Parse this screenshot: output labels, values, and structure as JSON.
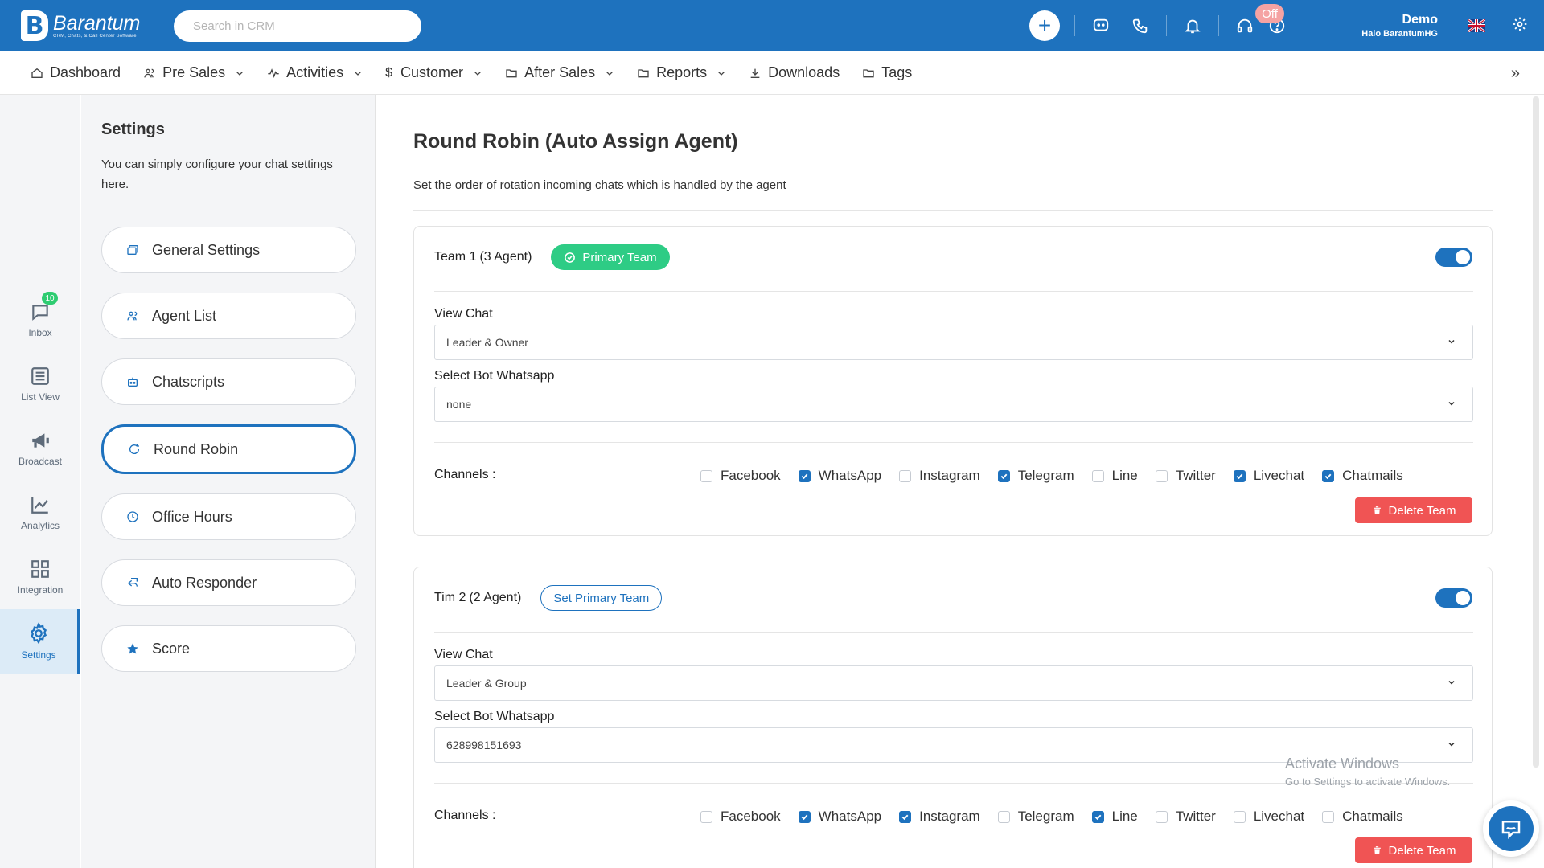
{
  "brand": {
    "name": "Barantum",
    "tagline": "CRM, Chats, & Call Center Software",
    "logo_letter": "B"
  },
  "search": {
    "placeholder": "Search in CRM"
  },
  "topbar": {
    "status_badge": "Off",
    "user_name": "Demo",
    "user_org": "Halo BarantumHG"
  },
  "menu": [
    {
      "label": "Dashboard",
      "icon": "home-icon",
      "dropdown": false
    },
    {
      "label": "Pre Sales",
      "icon": "users-icon",
      "dropdown": true
    },
    {
      "label": "Activities",
      "icon": "activity-icon",
      "dropdown": true
    },
    {
      "label": "Customer",
      "icon": "dollar-icon",
      "dropdown": true
    },
    {
      "label": "After Sales",
      "icon": "folder-icon",
      "dropdown": true
    },
    {
      "label": "Reports",
      "icon": "folder-icon",
      "dropdown": true
    },
    {
      "label": "Downloads",
      "icon": "download-icon",
      "dropdown": false
    },
    {
      "label": "Tags",
      "icon": "folder-icon",
      "dropdown": false
    }
  ],
  "rail": {
    "inbox_badge": "10",
    "items": [
      {
        "label": "Inbox",
        "icon": "chat-icon"
      },
      {
        "label": "List View",
        "icon": "list-icon"
      },
      {
        "label": "Broadcast",
        "icon": "megaphone-icon"
      },
      {
        "label": "Analytics",
        "icon": "chart-icon"
      },
      {
        "label": "Integration",
        "icon": "grid-icon"
      },
      {
        "label": "Settings",
        "icon": "gear-icon",
        "active": true
      }
    ]
  },
  "settings": {
    "title": "Settings",
    "description": "You can simply configure your chat settings here.",
    "items": [
      {
        "label": "General Settings",
        "icon": "window-icon"
      },
      {
        "label": "Agent List",
        "icon": "users-icon"
      },
      {
        "label": "Chatscripts",
        "icon": "robot-icon"
      },
      {
        "label": "Round Robin",
        "icon": "refresh-icon",
        "active": true
      },
      {
        "label": "Office Hours",
        "icon": "clock-icon"
      },
      {
        "label": "Auto Responder",
        "icon": "reply-icon"
      },
      {
        "label": "Score",
        "icon": "star-icon"
      }
    ]
  },
  "page": {
    "title": "Round Robin (Auto Assign Agent)",
    "description": "Set the order of rotation incoming chats which is handled by the agent"
  },
  "labels": {
    "view_chat": "View Chat",
    "select_bot": "Select Bot Whatsapp",
    "channels": "Channels :",
    "delete_team": "Delete Team",
    "primary_team": "Primary Team",
    "set_primary_team": "Set Primary Team"
  },
  "teams": [
    {
      "name": "Team 1",
      "count": "(3 Agent)",
      "is_primary": true,
      "enabled": true,
      "view_chat": "Leader & Owner",
      "bot": "none",
      "channels": [
        {
          "label": "Facebook",
          "checked": false
        },
        {
          "label": "WhatsApp",
          "checked": true
        },
        {
          "label": "Instagram",
          "checked": false
        },
        {
          "label": "Telegram",
          "checked": true
        },
        {
          "label": "Line",
          "checked": false
        },
        {
          "label": "Twitter",
          "checked": false
        },
        {
          "label": "Livechat",
          "checked": true
        },
        {
          "label": "Chatmails",
          "checked": true
        }
      ]
    },
    {
      "name": "Tim 2",
      "count": "(2 Agent)",
      "is_primary": false,
      "enabled": true,
      "view_chat": "Leader & Group",
      "bot": "628998151693",
      "channels": [
        {
          "label": "Facebook",
          "checked": false
        },
        {
          "label": "WhatsApp",
          "checked": true
        },
        {
          "label": "Instagram",
          "checked": true
        },
        {
          "label": "Telegram",
          "checked": false
        },
        {
          "label": "Line",
          "checked": true
        },
        {
          "label": "Twitter",
          "checked": false
        },
        {
          "label": "Livechat",
          "checked": false
        },
        {
          "label": "Chatmails",
          "checked": false
        }
      ]
    }
  ],
  "watermark": {
    "line1": "Activate Windows",
    "line2": "Go to Settings to activate Windows."
  },
  "colors": {
    "primary": "#1e72be",
    "success": "#2ecc85",
    "danger": "#f05454"
  }
}
